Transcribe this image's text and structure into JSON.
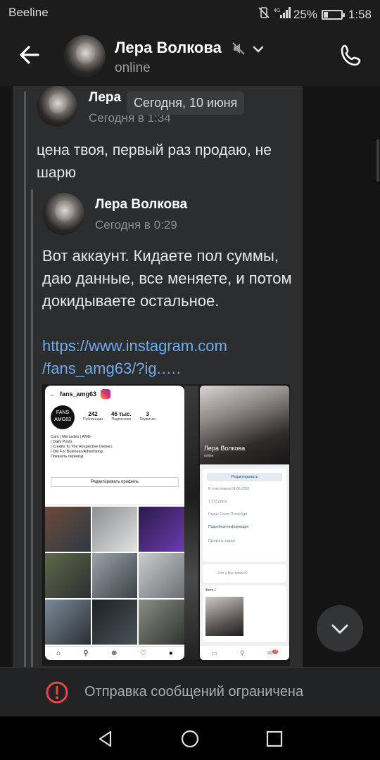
{
  "status_bar": {
    "carrier": "Beeline",
    "battery": "25%",
    "battery_level": 0.25,
    "time": "1:58"
  },
  "header": {
    "name": "Лера Волкова",
    "status": "online"
  },
  "chat": {
    "date_pill": "Сегодня, 10 июня",
    "forward1": {
      "author": "Лера",
      "time": "Сегодня в 1:34",
      "text": "цена твоя, первый раз продаю, не шарю"
    },
    "forward2": {
      "author": "Лера Волкова",
      "time": "Сегодня в 0:29",
      "text": "Вот аккаунт. Кидаете пол суммы, даю данные, все меняете, и потом докидываете остальное.",
      "link_line1": "https://www.instagram.com",
      "link_line2": "/fans_amg63/?ig.…."
    },
    "attachment": {
      "instagram": {
        "username": "fans_amg63",
        "logo_text": "FANS AMG63",
        "posts": "242",
        "posts_label": "Публикации",
        "followers": "46 тыс.",
        "followers_label": "Подписчики",
        "following": "3",
        "following_label": "Подписки",
        "bio_line1": "Cars | Mercedes | AMG",
        "bio_line2": "| Daily Posts",
        "bio_line3": "| Credits To The Respective Owners",
        "bio_line4": "| DM For Business/Advertising",
        "bio_line5": "Показать перевод",
        "edit_profile": "Редактировать профиль"
      },
      "vk": {
        "name": "Лера Волкова",
        "sub": "online",
        "edit": "Редактировать",
        "row1": "В счастливом 04.06.2020",
        "row2": "1 333 друга",
        "row3": "Город: Санкт-Петербург",
        "row4": "Подробная информация",
        "row5": "Профиль закрыт",
        "post_prompt": "Что у Вас нового?",
        "photos_label": "Фото",
        "photos_count": "1",
        "badge": "12"
      }
    }
  },
  "restriction": {
    "text": "Отправка сообщений ограничена"
  },
  "colors": {
    "background": "#141414",
    "bubble": "#2c2d2f",
    "link": "#71aaeb",
    "warning": "#e64646"
  }
}
